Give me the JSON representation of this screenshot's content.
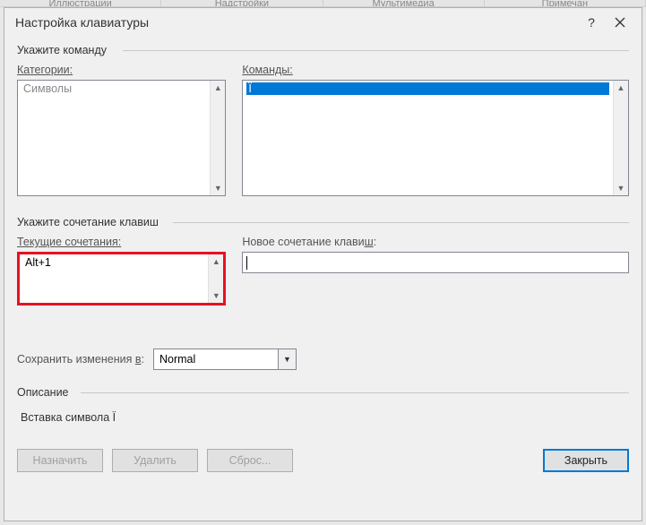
{
  "ribbon": {
    "tabs": [
      "Иллюстрации",
      "Надстройки",
      "Мультимедиа",
      "Примечан"
    ]
  },
  "dialog": {
    "title": "Настройка клавиатуры",
    "group_command": "Укажите команду",
    "categories_label": "Категории:",
    "categories_items": [
      "Символы"
    ],
    "commands_label": "Команды:",
    "commands_items": [
      "Ї"
    ],
    "group_keys": "Укажите сочетание клавиш",
    "current_label": "Текущие сочетания:",
    "current_items": [
      "Alt+1"
    ],
    "new_label_pre": "Новое сочетание клави",
    "new_label_ul": "ш",
    "new_label_post": ":",
    "new_value": "",
    "save_label_pre": "Сохранить изменения ",
    "save_label_ul": "в",
    "save_label_post": ":",
    "save_value": "Normal",
    "desc_group": "Описание",
    "desc_text": "Вставка символа Ї",
    "btn_assign": "Назначить",
    "btn_delete": "Удалить",
    "btn_reset": "Сброс...",
    "btn_close": "Закрыть"
  }
}
